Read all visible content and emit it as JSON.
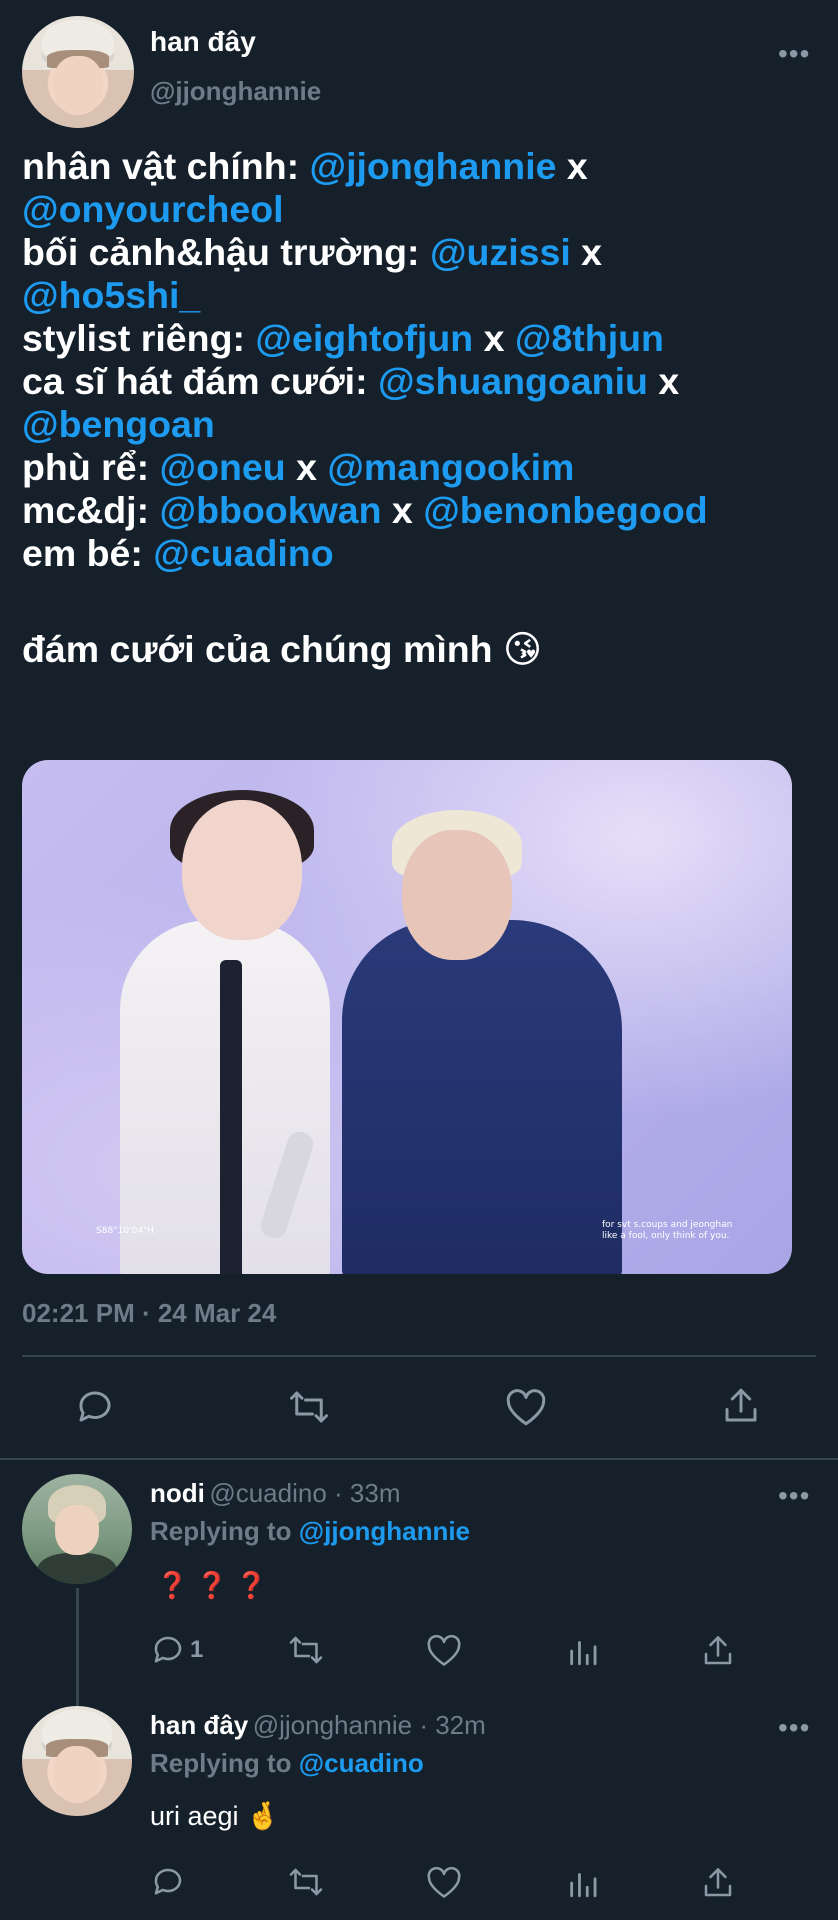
{
  "tweet": {
    "author_name": "han đây",
    "author_handle": "@jjonghannie",
    "more_label": "•••",
    "lines": [
      {
        "text": "nhân vật chính: ",
        "m1": "@jjonghannie",
        "sep": " x",
        "m2": ""
      },
      {
        "text": "",
        "m1": "@onyourcheol",
        "sep": "",
        "m2": ""
      },
      {
        "text": "bối cảnh&hậu trường: ",
        "m1": "@uzissi",
        "sep": " x",
        "m2": ""
      },
      {
        "text": "",
        "m1": "@ho5shi_",
        "sep": "",
        "m2": ""
      },
      {
        "text": "stylist riêng: ",
        "m1": "@eightofjun",
        "sep": " x ",
        "m2": "@8thjun"
      },
      {
        "text": "ca sĩ hát đám cưới: ",
        "m1": "@shuangoaniu",
        "sep": " x",
        "m2": ""
      },
      {
        "text": "",
        "m1": "@bengoan",
        "sep": "",
        "m2": ""
      },
      {
        "text": "phù rể: ",
        "m1": "@oneu",
        "sep": " x ",
        "m2": "@mangookim"
      },
      {
        "text": "mc&dj: ",
        "m1": "@bbookwan",
        "sep": " x ",
        "m2": "@benonbegood"
      },
      {
        "text": "em bé: ",
        "m1": "@cuadino",
        "sep": "",
        "m2": ""
      }
    ],
    "closing": "đám cưới của chúng mình 😘",
    "photo": {
      "caption_left": "S88°10'04\"H",
      "caption_right_1": "for svt s.coups and jeonghan",
      "caption_right_2": "like a fool, only think of you."
    },
    "timestamp": "02:21 PM · 24 Mar 24"
  },
  "replies": [
    {
      "name": "nodi",
      "meta": "@cuadino · 33m",
      "replying_prefix": "Replying to ",
      "replying_to": "@jjonghannie",
      "text": "❓ ❓ ❓",
      "reply_count": "1"
    },
    {
      "name": "han đây",
      "meta": "@jjonghannie · 32m",
      "replying_prefix": "Replying to ",
      "replying_to": "@cuadino",
      "text": "uri aegi 🤞",
      "reply_count": ""
    }
  ],
  "colors": {
    "background": "#15202b",
    "accent": "#1d9bf0",
    "muted": "#6e7c89",
    "divider": "#38444d"
  }
}
